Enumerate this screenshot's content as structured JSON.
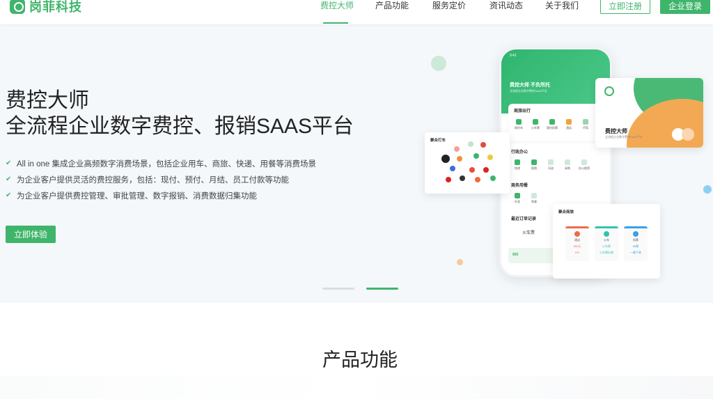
{
  "header": {
    "brand": "岗菲科技",
    "nav": [
      {
        "label": "费控大师",
        "active": true
      },
      {
        "label": "产品功能",
        "active": false
      },
      {
        "label": "服务定价",
        "active": false
      },
      {
        "label": "资讯动态",
        "active": false
      },
      {
        "label": "关于我们",
        "active": false
      }
    ],
    "register_label": "立即注册",
    "login_label": "企业登录"
  },
  "hero": {
    "title_line1": "费控大师",
    "title_line2": "全流程企业数字费控、报销SAAS平台",
    "features": [
      "All in one 集成企业高频数字消费场景，包括企业用车、商旅、快递、用餐等消费场景",
      "为企业客户提供灵活的费控服务，包括：现付、预付、月结、员工付款等功能",
      "为企业客户提供费控管理、审批管理、数字报销、消费数据归集功能"
    ],
    "cta_label": "立即体验",
    "carousel_active_index": 1
  },
  "phone": {
    "time": "9:41",
    "headline": "费控大师 不负所托",
    "subline": "全流程企业数字费控SaaS平台",
    "sections": {
      "travel": {
        "title": "商旅出行",
        "items": [
          "网约车",
          "火车票",
          "国内机票",
          "酒店",
          "代驾"
        ]
      },
      "office": {
        "title": "行政办公",
        "items": [
          "快递",
          "报销",
          "闪送",
          "采购",
          "办公租赁"
        ]
      },
      "meal": {
        "title": "商务用餐",
        "items": [
          "外卖",
          "到餐"
        ]
      },
      "orders": {
        "title": "最近订单记录",
        "item": "火车票",
        "amount": "900",
        "amount_note": "已付款金额"
      }
    }
  },
  "cards": {
    "taxi_title": "聚合打车",
    "brand_title": "费控大师",
    "brand_sub": "全流程企业数字费控SaaS平台",
    "trip_title": "聚合商旅",
    "trip_columns": [
      {
        "label": "酒店",
        "price": "960元",
        "note": "6%",
        "color": "#ee6b4d"
      },
      {
        "label": "火车",
        "price": "火车票",
        "note": "火车票价格",
        "color": "#2fc4b2"
      },
      {
        "label": "机票",
        "price": "¥6期",
        "note": "一键下单",
        "color": "#3aa0e8"
      }
    ]
  },
  "section2": {
    "title": "产品功能"
  }
}
